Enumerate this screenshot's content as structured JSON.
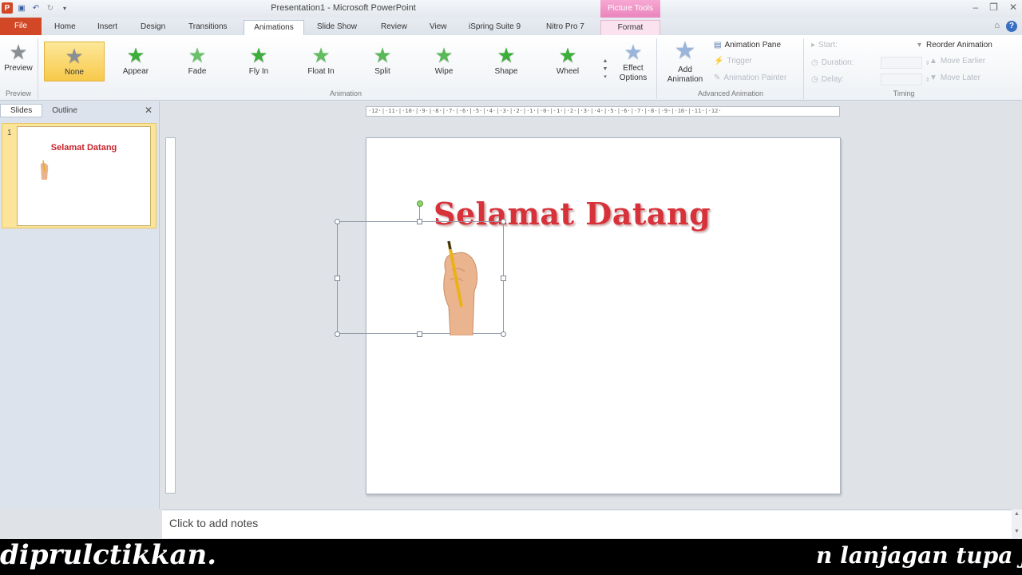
{
  "window": {
    "title": "Presentation1 - Microsoft PowerPoint",
    "context_tab_group": "Picture Tools"
  },
  "tabs": [
    "File",
    "Home",
    "Insert",
    "Design",
    "Transitions",
    "Animations",
    "Slide Show",
    "Review",
    "View",
    "iSpring Suite 9",
    "Nitro Pro 7",
    "Format"
  ],
  "active_tab": "Animations",
  "ribbon": {
    "preview": {
      "label": "Preview",
      "group": "Preview"
    },
    "animation_group": "Animation",
    "animations": [
      "None",
      "Appear",
      "Fade",
      "Fly In",
      "Float In",
      "Split",
      "Wipe",
      "Shape",
      "Wheel"
    ],
    "selected_animation": "None",
    "effect_options": "Effect Options",
    "advanced_group": "Advanced Animation",
    "add_animation": "Add Animation",
    "animation_pane": "Animation Pane",
    "trigger": "Trigger",
    "animation_painter": "Animation Painter",
    "timing_group": "Timing",
    "start": "Start:",
    "duration": "Duration:",
    "delay": "Delay:",
    "reorder": "Reorder Animation",
    "move_earlier": "Move Earlier",
    "move_later": "Move Later"
  },
  "panel": {
    "tabs": [
      "Slides",
      "Outline"
    ],
    "slide_number": "1",
    "thumb_title": "Selamat Datang"
  },
  "slide": {
    "title": "Selamat Datang"
  },
  "notes_placeholder": "Click to add notes",
  "caption": {
    "left": "diprulctikkan.",
    "right": "n lanjagan tupa jus"
  },
  "colors": {
    "file_tab": "#d24726",
    "picture_tools": "#ea84bd",
    "title_red": "#d73139",
    "selected_gallery": "#f8c94a"
  }
}
